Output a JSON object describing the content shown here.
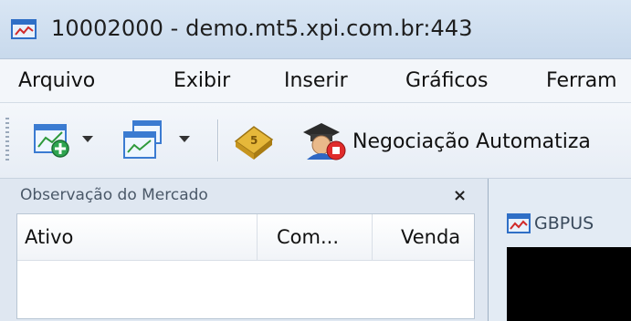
{
  "window": {
    "title": "10002000 - demo.mt5.xpi.com.br:443"
  },
  "menu": {
    "items": [
      "Arquivo",
      "Exibir",
      "Inserir",
      "Gráficos",
      "Ferram"
    ]
  },
  "toolbar": {
    "new_chart_icon": "new-chart-icon",
    "profiles_icon": "profiles-icon",
    "strategy_icon": "strategy-tester-icon",
    "auto_trading_icon": "auto-trading-icon",
    "auto_trading_label": "Negociação Automatiza"
  },
  "market_watch": {
    "title": "Observação do Mercado",
    "close_glyph": "×",
    "columns": [
      "Ativo",
      "Com...",
      "Venda"
    ]
  },
  "chart_window": {
    "title": "GBPUS"
  },
  "colors": {
    "accent": "#1e6fd9",
    "chart_background": "#000000"
  }
}
